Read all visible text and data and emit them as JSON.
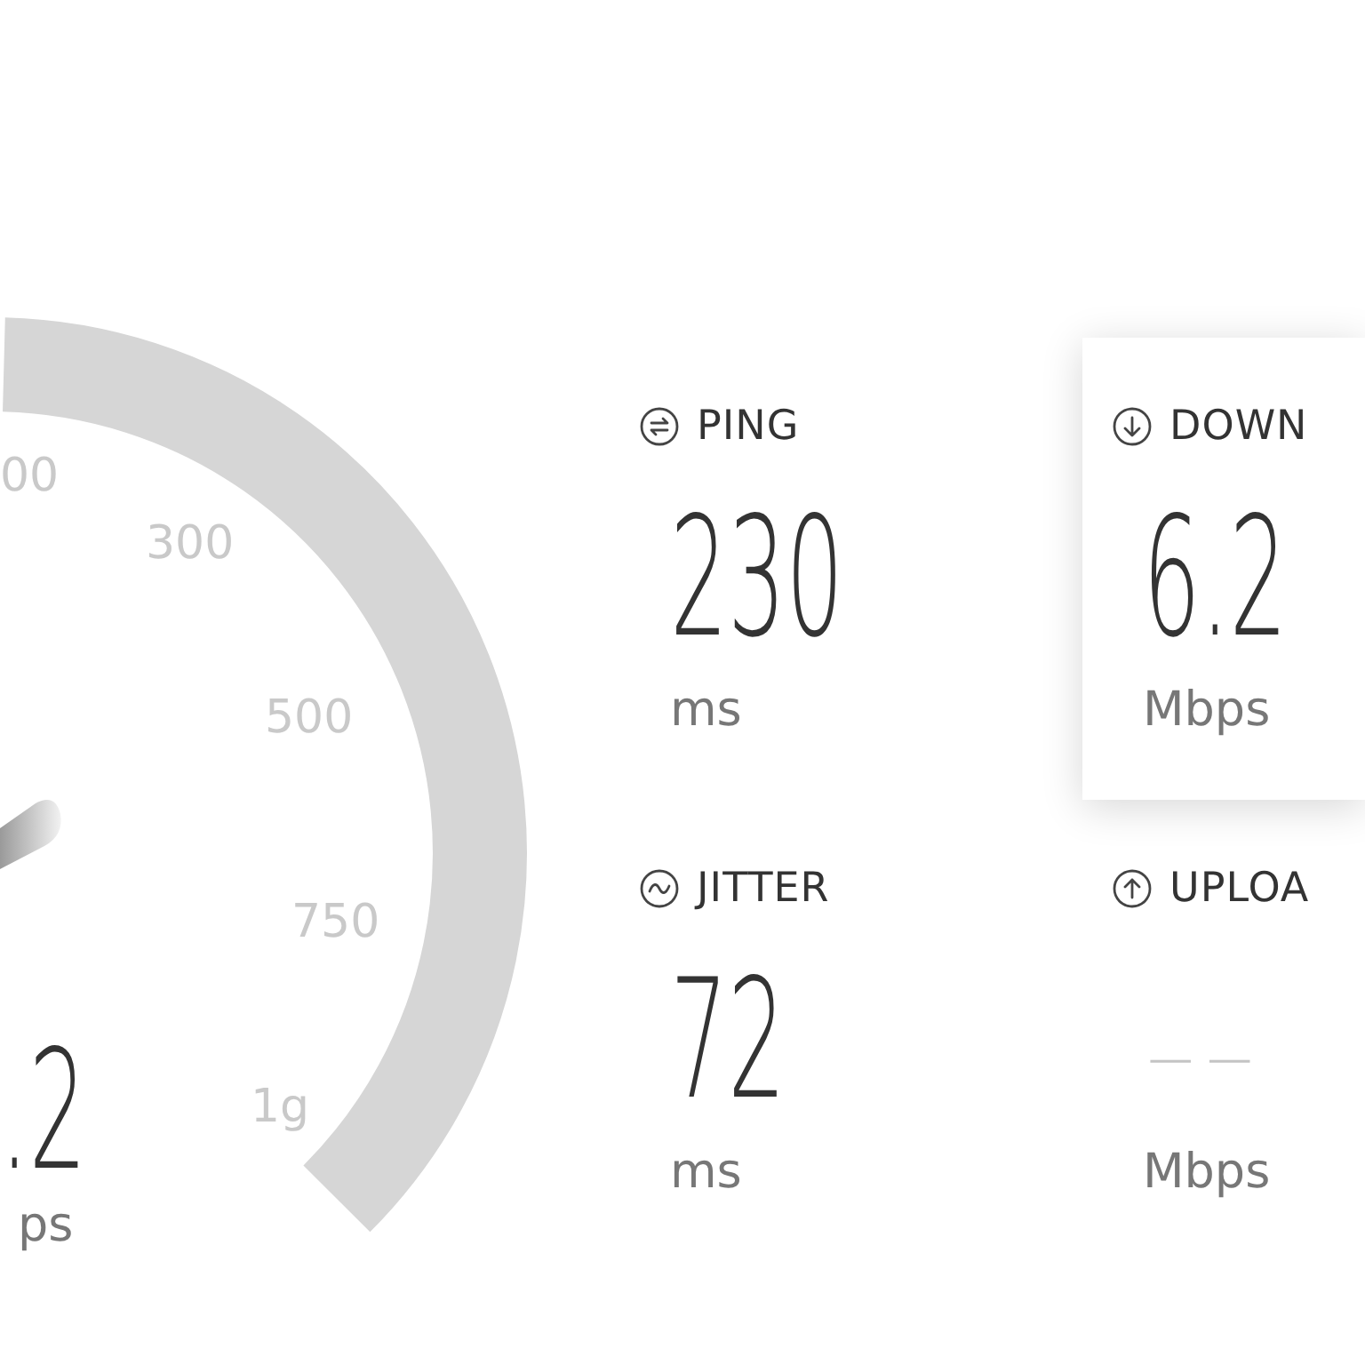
{
  "gauge": {
    "tick_labels": [
      "00",
      "300",
      "500",
      "750",
      "1g"
    ],
    "value": ".2",
    "unit": "ps"
  },
  "metrics": [
    {
      "kind": "ping",
      "label": "PING",
      "value": "230",
      "unit": "ms",
      "selected": false,
      "pending": false
    },
    {
      "kind": "download",
      "label": "DOWN",
      "value": "6.2",
      "unit": "Mbps",
      "selected": true,
      "pending": false
    },
    {
      "kind": "jitter",
      "label": "JITTER",
      "value": "72",
      "unit": "ms",
      "selected": false,
      "pending": false
    },
    {
      "kind": "upload",
      "label": "UPLOA",
      "value": "— —",
      "unit": "Mbps",
      "selected": false,
      "pending": true
    }
  ]
}
